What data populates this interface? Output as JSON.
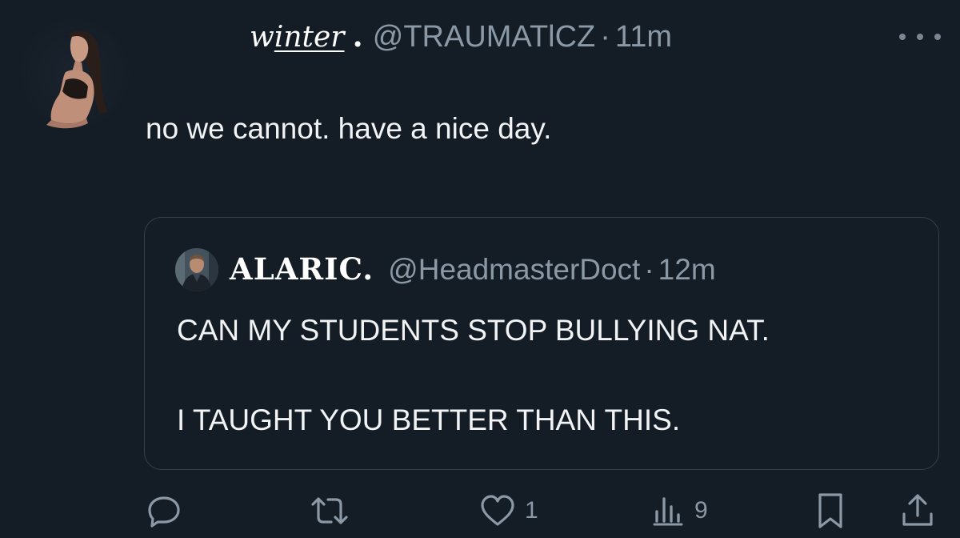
{
  "tweet": {
    "display_name_pre": "w",
    "display_name_underlined": "inter",
    "name_dot": ".",
    "handle": "@TRAUMATlCZ",
    "separator": "·",
    "time": "11m",
    "text": "no we cannot. have a nice day."
  },
  "quote": {
    "display_name": "ALARIC.",
    "handle": "@HeadmasterDoct",
    "separator": "·",
    "time": "12m",
    "line1": "CAN MY STUDENTS STOP BULLYING NAT.",
    "line2": "I TAUGHT YOU BETTER THAN THIS."
  },
  "actions": {
    "reply_icon": "reply-icon",
    "retweet_icon": "retweet-icon",
    "like_icon": "heart-icon",
    "like_count": "1",
    "views_icon": "views-icon",
    "views_count": "9",
    "bookmark_icon": "bookmark-icon",
    "share_icon": "share-icon"
  },
  "colors": {
    "background": "#141c26",
    "text": "#f1f3f4",
    "secondary_text": "#8b98a5",
    "border": "#34404d"
  }
}
